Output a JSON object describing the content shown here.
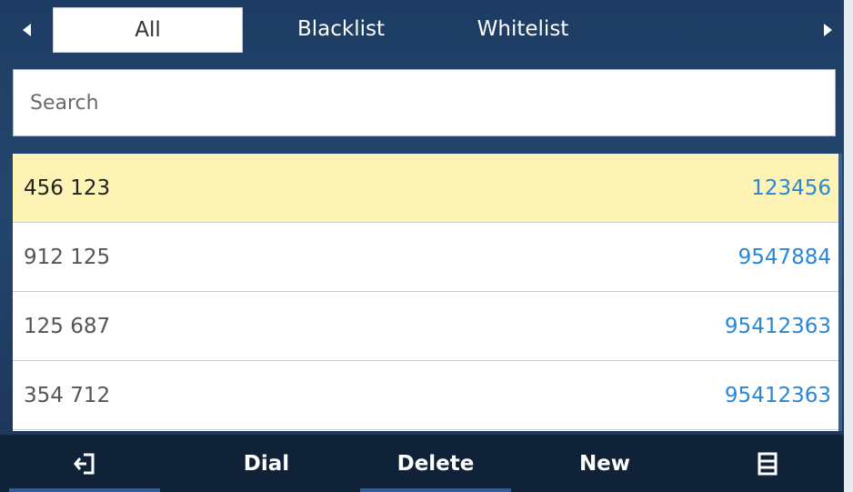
{
  "tabs": {
    "left_arrow": "◀",
    "right_arrow": "▶",
    "items": [
      {
        "label": "All"
      },
      {
        "label": "Blacklist"
      },
      {
        "label": "Whitelist"
      }
    ]
  },
  "search": {
    "placeholder": "Search",
    "value": ""
  },
  "contacts": [
    {
      "name": "456 123",
      "number": "123456"
    },
    {
      "name": "912 125",
      "number": "9547884"
    },
    {
      "name": "125 687",
      "number": "95412363"
    },
    {
      "name": "354 712",
      "number": "95412363"
    }
  ],
  "softkeys": {
    "back_icon": "back-icon",
    "dial": "Dial",
    "delete": "Delete",
    "new": "New",
    "menu_icon": "menu-icon"
  },
  "colors": {
    "selected_row": "#fdf3b4",
    "number_text": "#2a86d6",
    "header_bg": "#1d3c63"
  }
}
